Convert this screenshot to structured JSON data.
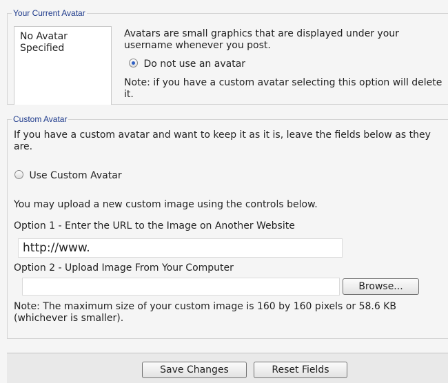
{
  "current_avatar": {
    "legend": "Your Current Avatar",
    "avatar_placeholder": "No Avatar Specified",
    "description": "Avatars are small graphics that are displayed under your username whenever you post.",
    "no_avatar_option": "Do not use an avatar",
    "note": "Note: if you have a custom avatar selecting this option will delete it."
  },
  "custom_avatar": {
    "legend": "Custom Avatar",
    "intro": "If you have a custom avatar and want to keep it as it is, leave the fields below as they are.",
    "use_custom_option": "Use Custom Avatar",
    "upload_intro": "You may upload a new custom image using the controls below.",
    "option1_label": "Option 1 - Enter the URL to the Image on Another Website",
    "url_value": "http://www.",
    "option2_label": "Option 2 - Upload Image From Your Computer",
    "file_value": "",
    "browse_label": "Browse...",
    "size_note": "Note: The maximum size of your custom image is 160 by 160 pixels or 58.6 KB (whichever is smaller)."
  },
  "actions": {
    "save_label": "Save Changes",
    "reset_label": "Reset Fields"
  },
  "colors": {
    "legend": "#1f3b8c",
    "radio_selected": "#2c5ec4"
  }
}
